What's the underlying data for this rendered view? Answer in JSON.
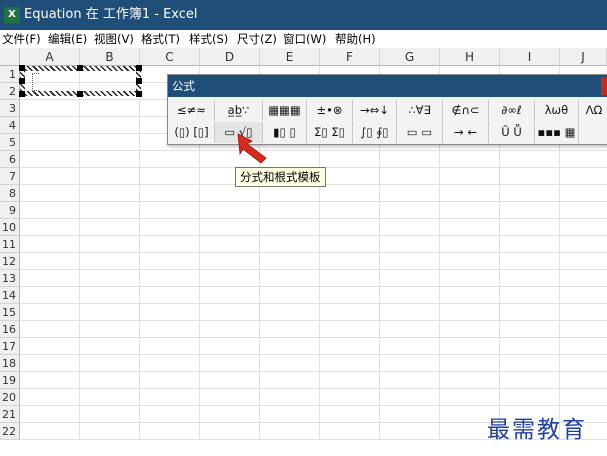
{
  "window": {
    "app_icon": "X",
    "title": "Equation 在 工作簿1 - Excel"
  },
  "menu": [
    "文件(F)",
    "编辑(E)",
    "视图(V)",
    "格式(T)",
    "样式(S)",
    "尺寸(Z)",
    "窗口(W)",
    "帮助(H)"
  ],
  "columns": [
    "A",
    "B",
    "C",
    "D",
    "E",
    "F",
    "G",
    "H",
    "I",
    "J"
  ],
  "rows": [
    "1",
    "2",
    "3",
    "4",
    "5",
    "6",
    "7",
    "8",
    "9",
    "10",
    "11",
    "12",
    "13",
    "14",
    "15",
    "16",
    "17",
    "18",
    "19",
    "20",
    "21",
    "22"
  ],
  "palette": {
    "title": "公式",
    "row1": [
      "≤≠≈",
      "a̲b̲∵",
      "▦▦▦",
      "±•⊗",
      "→⇔↓",
      "∴∀∃",
      "∉∩⊂",
      "∂∞ℓ",
      "λωθ",
      "ΛΩ"
    ],
    "row2": [
      "(▯) [▯]",
      "▭ √▯",
      "▮▯ ▯",
      "Σ▯ Σ▯",
      "∫▯ ∮▯",
      "▭ ▭",
      "→ ←",
      "Ū Ṻ",
      "▪▪▪ ▦"
    ]
  },
  "tooltip": "分式和根式模板",
  "watermark": "最需教育",
  "colors": {
    "title_bar": "#1f4e79",
    "excel_green": "#217346",
    "arrow": "#d9291c",
    "tooltip_bg": "#ffffe1"
  }
}
